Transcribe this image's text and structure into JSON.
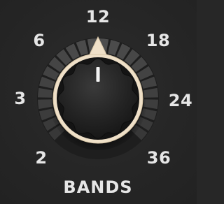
{
  "control": {
    "label": "BANDS",
    "ticks": [
      "2",
      "3",
      "6",
      "12",
      "18",
      "24",
      "36"
    ],
    "value": "12",
    "accent_color": "#efe0c8"
  }
}
